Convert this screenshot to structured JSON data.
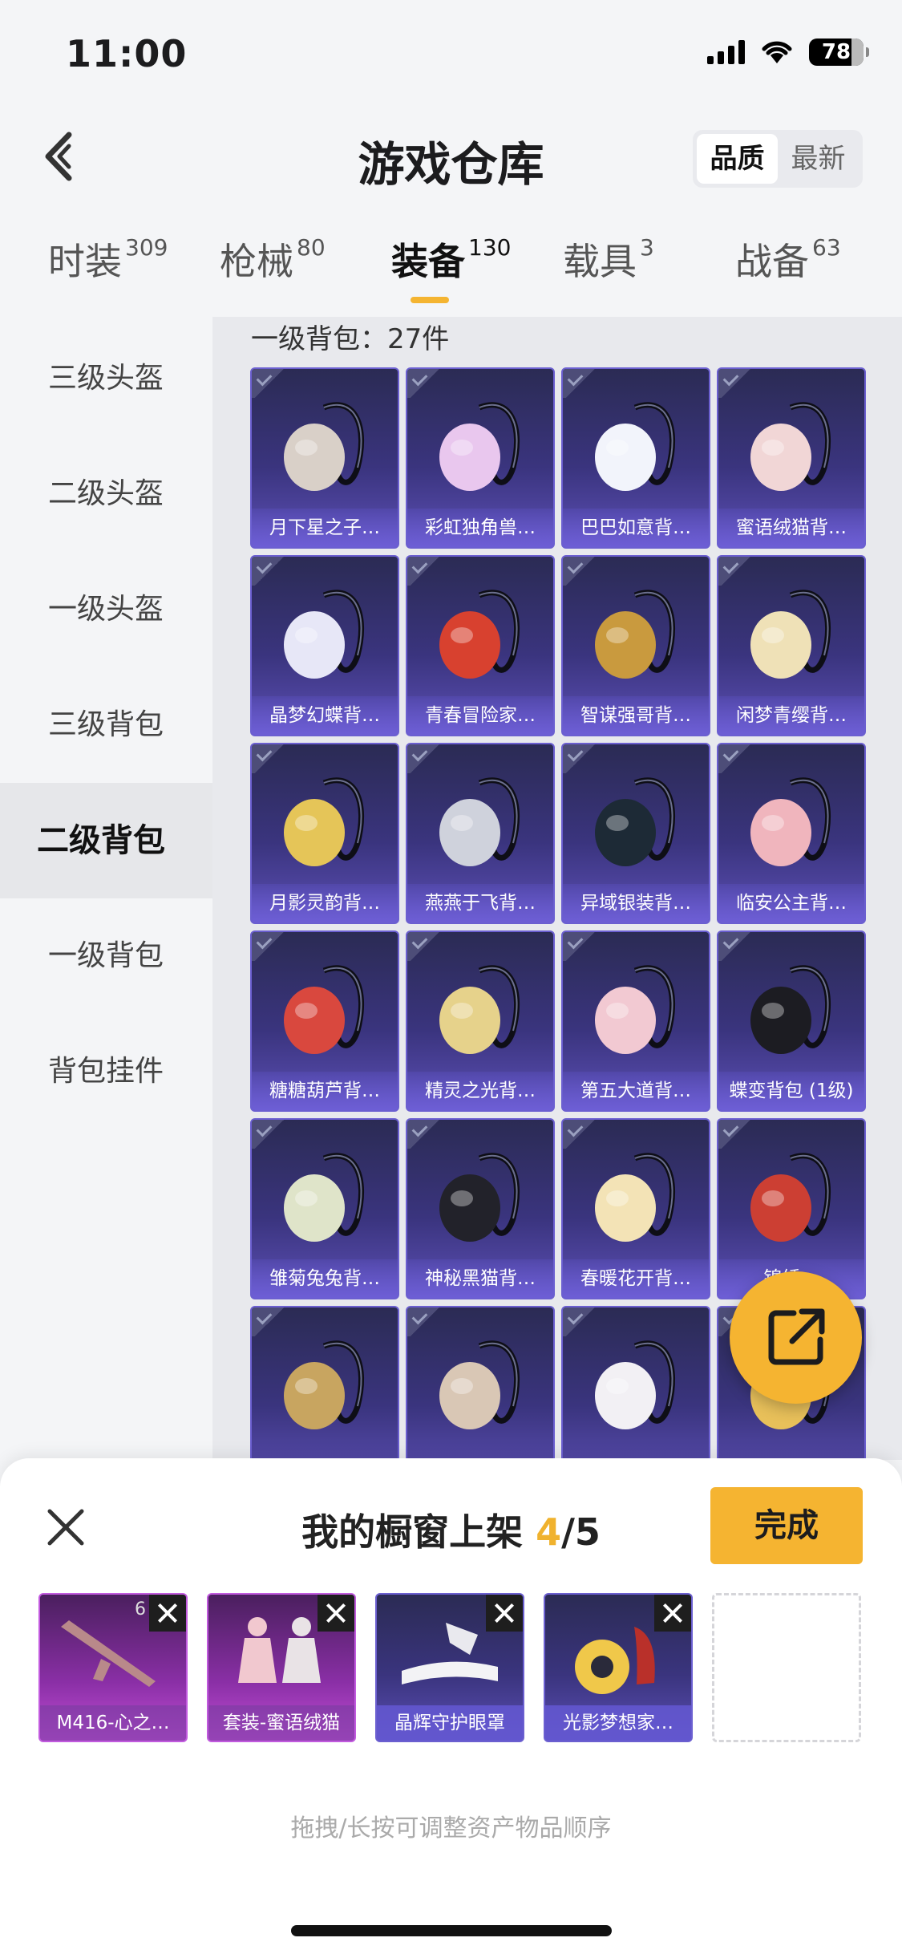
{
  "status": {
    "time": "11:00",
    "battery": "78"
  },
  "header": {
    "title": "游戏仓库",
    "sort": [
      "品质",
      "最新"
    ]
  },
  "tabs": [
    {
      "label": "时装",
      "count": "309"
    },
    {
      "label": "枪械",
      "count": "80"
    },
    {
      "label": "装备",
      "count": "130"
    },
    {
      "label": "载具",
      "count": "3"
    },
    {
      "label": "战备",
      "count": "63"
    }
  ],
  "sidebar": [
    "三级头盔",
    "二级头盔",
    "一级头盔",
    "三级背包",
    "二级背包",
    "一级背包",
    "背包挂件"
  ],
  "content": {
    "section_title": "一级背包：27件",
    "items": [
      {
        "label": "月下星之子…",
        "icon": "white-moon-backpack-icon",
        "color": "#d9d0c8"
      },
      {
        "label": "彩虹独角兽…",
        "icon": "unicorn-backpack-icon",
        "color": "#e9c7ee"
      },
      {
        "label": "巴巴如意背…",
        "icon": "bunny-backpack-icon",
        "color": "#f2f4fb"
      },
      {
        "label": "蜜语绒猫背…",
        "icon": "pink-bag-backpack-icon",
        "color": "#f1d6d6"
      },
      {
        "label": "晶梦幻蝶背…",
        "icon": "butterfly-backpack-icon",
        "color": "#e7e7f7"
      },
      {
        "label": "青春冒险家…",
        "icon": "red-rooster-backpack-icon",
        "color": "#d8412f"
      },
      {
        "label": "智谋强哥背…",
        "icon": "mask-backpack-icon",
        "color": "#c99a3e"
      },
      {
        "label": "闲梦青缨背…",
        "icon": "shell-backpack-icon",
        "color": "#efe1b7"
      },
      {
        "label": "月影灵韵背…",
        "icon": "gold-coin-backpack-icon",
        "color": "#e5c558"
      },
      {
        "label": "燕燕于飞背…",
        "icon": "swallow-backpack-icon",
        "color": "#cfd2dc"
      },
      {
        "label": "异域银装背…",
        "icon": "dark-box-backpack-icon",
        "color": "#1d2a36"
      },
      {
        "label": "临安公主背…",
        "icon": "flower-backpack-icon",
        "color": "#f0b5bd"
      },
      {
        "label": "糖糖葫芦背…",
        "icon": "gourd-backpack-icon",
        "color": "#d9483e"
      },
      {
        "label": "精灵之光背…",
        "icon": "fairy-light-backpack-icon",
        "color": "#e6d28b"
      },
      {
        "label": "第五大道背…",
        "icon": "quilted-bag-backpack-icon",
        "color": "#f2c9d2"
      },
      {
        "label": "蝶变背包 (1级)",
        "icon": "black-bunny-backpack-icon",
        "color": "#1c1c22"
      },
      {
        "label": "雏菊兔兔背…",
        "icon": "daisy-backpack-icon",
        "color": "#dfe4c9"
      },
      {
        "label": "神秘黑猫背…",
        "icon": "black-cat-backpack-icon",
        "color": "#22222a"
      },
      {
        "label": "春暖花开背…",
        "icon": "spring-flower-backpack-icon",
        "color": "#f3e3b6"
      },
      {
        "label": "锦绣…",
        "icon": "red-brocade-backpack-icon",
        "color": "#cc3f33"
      },
      {
        "label": "",
        "icon": "mask-shield-backpack-icon",
        "color": "#c8a560"
      },
      {
        "label": "",
        "icon": "bronze-backpack-icon",
        "color": "#d9c7b5"
      },
      {
        "label": "",
        "icon": "white-bow-backpack-icon",
        "color": "#f2f0f4"
      },
      {
        "label": "",
        "icon": "star-backpack-icon",
        "color": "#e8c05a"
      }
    ]
  },
  "share": {
    "icon": "external-link-icon"
  },
  "sheet": {
    "title_prefix": "我的橱窗上架 ",
    "current": "4",
    "total": "/5",
    "done_label": "完成",
    "slots": [
      {
        "label": "M416-心之…",
        "badge": "6",
        "style": "purple",
        "icon": "rifle-icon"
      },
      {
        "label": "套装-蜜语绒猫",
        "badge": "",
        "style": "purple",
        "icon": "outfit-icon"
      },
      {
        "label": "晶辉守护眼罩",
        "badge": "",
        "style": "blue",
        "icon": "eye-mask-icon"
      },
      {
        "label": "光影梦想家…",
        "badge": "",
        "style": "blue",
        "icon": "bee-helmet-icon"
      }
    ],
    "hint": "拖拽/长按可调整资产物品顺序"
  }
}
